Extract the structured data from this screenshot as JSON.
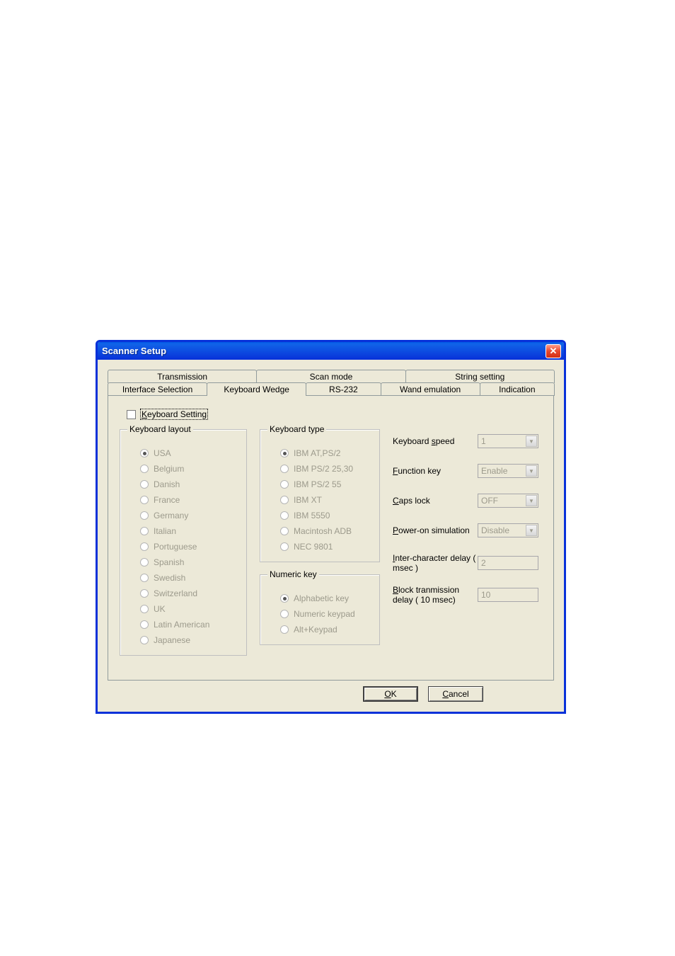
{
  "window": {
    "title": "Scanner Setup"
  },
  "tabs_back": [
    "Transmission",
    "Scan mode",
    "String setting"
  ],
  "tabs_front": [
    "Interface Selection",
    "Keyboard Wedge",
    "RS-232",
    "Wand emulation",
    "Indication"
  ],
  "active_front_tab": "Keyboard Wedge",
  "checkbox": {
    "label_pre": "K",
    "label_rest": "eyboard Setting",
    "checked": false
  },
  "groups": {
    "layout": {
      "legend": "Keyboard layout",
      "options": [
        "USA",
        "Belgium",
        "Danish",
        "France",
        "Germany",
        "Italian",
        "Portuguese",
        "Spanish",
        "Swedish",
        "Switzerland",
        "UK",
        "Latin American",
        "Japanese"
      ],
      "selected": "USA"
    },
    "type": {
      "legend": "Keyboard type",
      "options": [
        "IBM AT,PS/2",
        "IBM PS/2 25,30",
        "IBM PS/2 55",
        "IBM XT",
        "IBM 5550",
        "Macintosh ADB",
        "NEC 9801"
      ],
      "selected": "IBM AT,PS/2"
    },
    "numeric": {
      "legend": "Numeric key",
      "options": [
        "Alphabetic key",
        "Numeric keypad",
        "Alt+Keypad"
      ],
      "selected": "Alphabetic key"
    }
  },
  "fields": {
    "speed": {
      "label_u": "s",
      "label_pre": "Keyboard ",
      "label_post": "peed",
      "value": "1",
      "type": "combo"
    },
    "func": {
      "label_u": "F",
      "label_pre": "",
      "label_post": "unction key",
      "value": "Enable",
      "type": "combo"
    },
    "caps": {
      "label_u": "C",
      "label_pre": "",
      "label_post": "aps lock",
      "value": "OFF",
      "type": "combo"
    },
    "poweron": {
      "label_u": "P",
      "label_pre": "",
      "label_post": "ower-on simulation",
      "value": "Disable",
      "type": "combo"
    },
    "inter": {
      "label_u": "I",
      "label_pre": "",
      "label_post": "nter-character delay ( msec )",
      "value": "2",
      "type": "text"
    },
    "block": {
      "label_u": "B",
      "label_pre": "",
      "label_post": "lock tranmission delay ( 10 msec)",
      "value": "10",
      "type": "text"
    }
  },
  "buttons": {
    "ok_u": "O",
    "ok_rest": "K",
    "cancel_u": "C",
    "cancel_rest": "ancel"
  }
}
